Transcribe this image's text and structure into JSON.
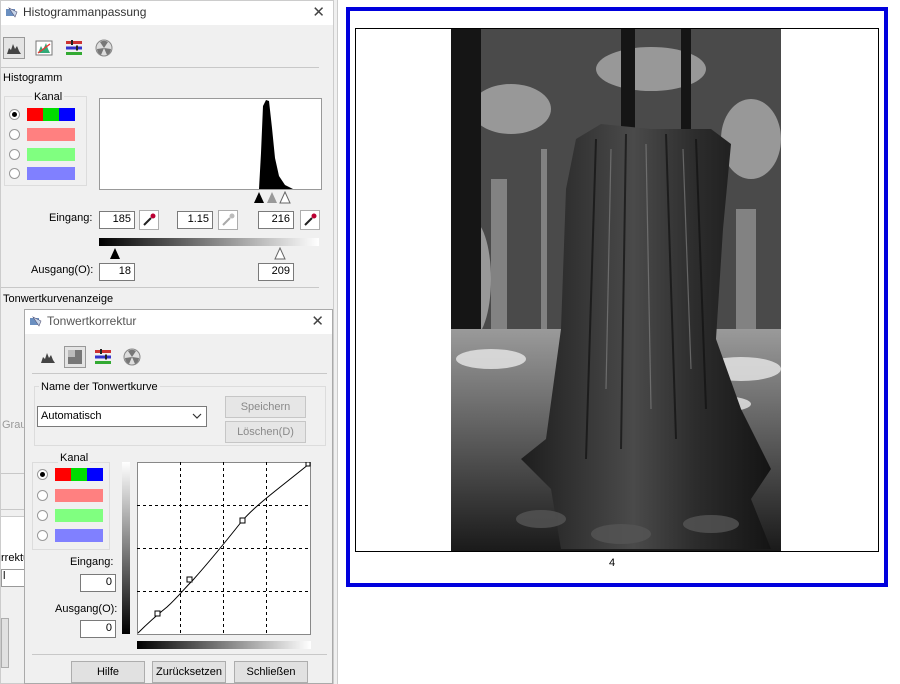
{
  "histogram_window": {
    "title": "Histogrammanpassung",
    "section_histogram": "Histogramm",
    "channel_label": "Kanal",
    "input_label": "Eingang:",
    "input_black": "185",
    "input_gamma": "1.15",
    "input_white": "216",
    "output_label": "Ausgang(O):",
    "output_black": "18",
    "output_white": "209",
    "section_curve": "Tonwertkurvenanzeige",
    "partial_label_grau": "Grau",
    "partial_label_korrektur": "rrektu",
    "partial_field": "l"
  },
  "tone_window": {
    "title": "Tonwertkorrektur",
    "curve_name_group_label": "Name der Tonwertkurve",
    "curve_name_value": "Automatisch",
    "save_button": "Speichern",
    "delete_button": "Löschen(D)",
    "channel_label": "Kanal",
    "input_label": "Eingang:",
    "input_value": "0",
    "output_label": "Ausgang(O):",
    "output_value": "0",
    "help_button": "Hilfe",
    "reset_button": "Zurücksetzen",
    "close_button": "Schließen"
  },
  "preview": {
    "page_number": "4",
    "frame_color": "#0000dd"
  },
  "icons": [
    "app-icon",
    "histogram-icon",
    "color-histogram-icon",
    "settings-icon",
    "radioactive-icon",
    "eyedropper-icon",
    "close-icon",
    "chevron-down-icon"
  ],
  "colors": {
    "red": "#ff0000",
    "green": "#00dd00",
    "blue": "#0000ff",
    "light_red": "#ff8080",
    "light_green": "#80ff80",
    "light_blue": "#8080ff"
  }
}
